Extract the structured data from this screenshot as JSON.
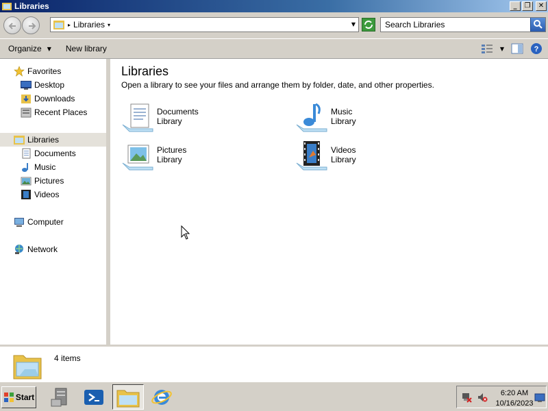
{
  "window": {
    "title": "Libraries",
    "controls": [
      "_",
      "❐",
      "✕"
    ]
  },
  "address": {
    "crumb": "Libraries",
    "search_placeholder": "Search Libraries"
  },
  "commands": {
    "organize": "Organize",
    "new_library": "New library"
  },
  "nav": {
    "favorites": "Favorites",
    "desktop": "Desktop",
    "downloads": "Downloads",
    "recent_places": "Recent Places",
    "libraries": "Libraries",
    "documents": "Documents",
    "music": "Music",
    "pictures": "Pictures",
    "videos": "Videos",
    "computer": "Computer",
    "network": "Network"
  },
  "content": {
    "heading": "Libraries",
    "subtitle": "Open a library to see your files and arrange them by folder, date, and other properties.",
    "libraries": [
      {
        "name": "Documents",
        "type": "Library",
        "icon": "documents-library-icon"
      },
      {
        "name": "Music",
        "type": "Library",
        "icon": "music-library-icon"
      },
      {
        "name": "Pictures",
        "type": "Library",
        "icon": "pictures-library-icon"
      },
      {
        "name": "Videos",
        "type": "Library",
        "icon": "videos-library-icon"
      }
    ]
  },
  "details": {
    "count": "4 items"
  },
  "taskbar": {
    "start": "Start",
    "time": "6:20 AM",
    "date": "10/16/2023"
  },
  "colors": {
    "title_bar_start": "#0a246a",
    "title_bar_end": "#a6caf0",
    "chrome": "#d4d0c8",
    "selection": "#e4e1da"
  }
}
